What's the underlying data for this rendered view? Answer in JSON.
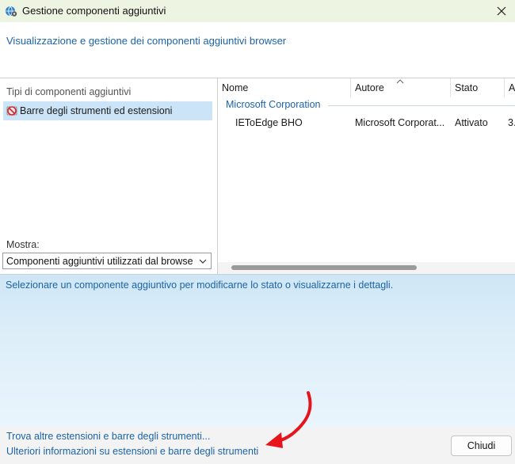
{
  "window": {
    "title": "Gestione componenti aggiuntivi",
    "icon": "settings-globe-icon"
  },
  "header": {
    "text": "Visualizzazione e gestione dei componenti aggiuntivi browser"
  },
  "left_pane": {
    "types_label": "Tipi di componenti aggiuntivi",
    "types": [
      {
        "label": "Barre degli strumenti ed estensioni",
        "icon": "toolbar-extension-icon",
        "selected": true
      }
    ],
    "show_label": "Mostra:",
    "show_select_value": "Componenti aggiuntivi utilizzati dal browse"
  },
  "list": {
    "columns": [
      "Nome",
      "Autore",
      "Stato",
      "A"
    ],
    "groups": [
      {
        "name": "Microsoft Corporation",
        "rows": [
          {
            "nome": "IEToEdge BHO",
            "autore": "Microsoft Corporat...",
            "stato": "Attivato",
            "a": "3."
          }
        ]
      }
    ]
  },
  "details": {
    "text": "Selezionare un componente aggiuntivo per modificarne lo stato o visualizzarne i dettagli."
  },
  "footer": {
    "link_find": "Trova altre estensioni e barre degli strumenti...",
    "link_more_info": "Ulteriori informazioni su estensioni e barre degli strumenti",
    "close_button": "Chiudi"
  },
  "colors": {
    "link": "#1b63a8",
    "selection": "#cce4f7",
    "annotation_arrow": "#e8141b"
  }
}
